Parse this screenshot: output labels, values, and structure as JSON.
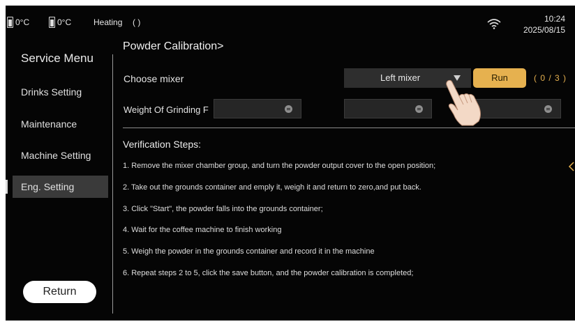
{
  "status_bar": {
    "temp_1": "0°C",
    "temp_2": "0°C",
    "heating_label": "Heating",
    "heating_value": "( )",
    "time": "10:24",
    "date": "2025/08/15"
  },
  "sidebar": {
    "title": "Service Menu",
    "items": [
      {
        "label": "Drinks Setting"
      },
      {
        "label": "Maintenance"
      },
      {
        "label": "Machine Setting"
      },
      {
        "label": "Eng. Setting"
      }
    ],
    "active_index": 3,
    "return_label": "Return"
  },
  "main": {
    "title": "Powder Calibration>",
    "choose_mixer_label": "Choose mixer",
    "mixer_selected": "Left mixer",
    "run_label": "Run",
    "counter": "( 0 / 3 )",
    "weight_label": "Weight Of Grinding F",
    "weight_fields": [
      "",
      "",
      ""
    ],
    "steps_title": "Verification Steps:",
    "steps": [
      "1. Remove the mixer chamber group, and turn the powder output cover to the open position;",
      "2. Take out the grounds container and emply it, weigh it and return to zero,and put back.",
      "3. Click \"Start\", the powder falls into the grounds container;",
      "4. Wait for the coffee machine to finish working",
      "5. Weigh the powder in the grounds container and record it in the machine",
      "6. Repeat steps 2 to 5, click the save button, and the powder calibration is completed;"
    ]
  },
  "colors": {
    "background": "#050505",
    "accent": "#e6b14f",
    "active_item": "#3a3a3a"
  }
}
